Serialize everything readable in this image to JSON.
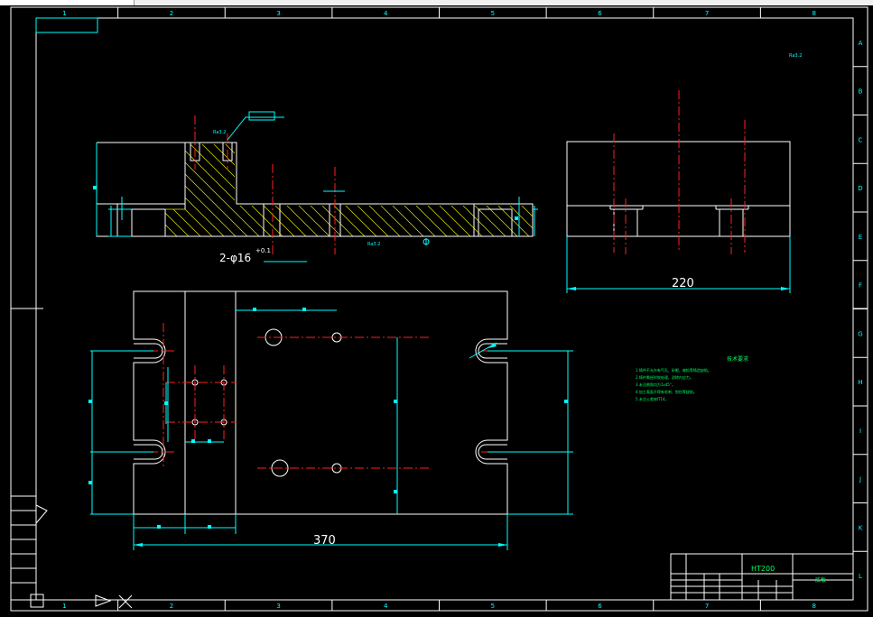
{
  "grid": {
    "columns": [
      "1",
      "2",
      "3",
      "4",
      "5",
      "6",
      "7",
      "8"
    ],
    "rows": [
      "A",
      "B",
      "C",
      "D",
      "E",
      "F",
      "G",
      "H",
      "I",
      "J",
      "K",
      "L"
    ]
  },
  "dimensions": {
    "side_width": "220",
    "plan_width": "370",
    "hole_callout": "2-φ16",
    "hole_tolerance": "+0.1"
  },
  "surface_marks": {
    "top_right": "Ra3.2",
    "section_top": "Ra3.2",
    "section_bottom": "Ra3.2"
  },
  "notes": {
    "title": "技术要求",
    "lines": [
      "1.铸件不允许有气孔、砂眼、缩松等铸造缺陷。",
      "2.铸件需经时效处理，消除内应力。",
      "3.未注倒角均为1x45°。",
      "4.加工表面不得有毛刺、划伤等缺陷。",
      "5.未注公差按IT14。"
    ]
  },
  "title_block": {
    "material": "HT200",
    "part_name": "底板"
  }
}
